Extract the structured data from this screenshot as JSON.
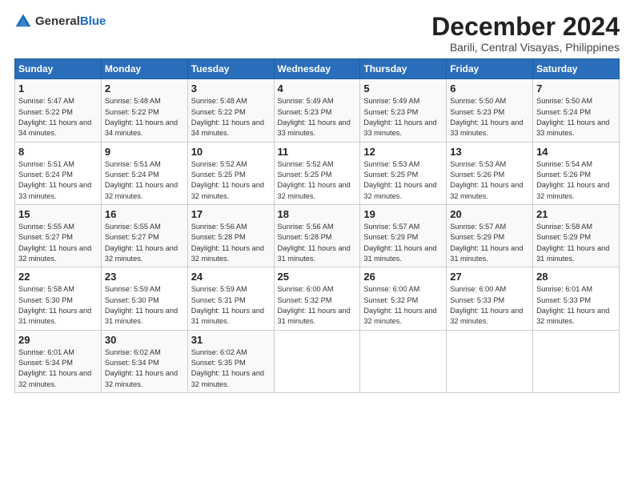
{
  "logo": {
    "general": "General",
    "blue": "Blue"
  },
  "title": "December 2024",
  "location": "Barili, Central Visayas, Philippines",
  "weekdays": [
    "Sunday",
    "Monday",
    "Tuesday",
    "Wednesday",
    "Thursday",
    "Friday",
    "Saturday"
  ],
  "weeks": [
    [
      {
        "day": "1",
        "sunrise": "Sunrise: 5:47 AM",
        "sunset": "Sunset: 5:22 PM",
        "daylight": "Daylight: 11 hours and 34 minutes."
      },
      {
        "day": "2",
        "sunrise": "Sunrise: 5:48 AM",
        "sunset": "Sunset: 5:22 PM",
        "daylight": "Daylight: 11 hours and 34 minutes."
      },
      {
        "day": "3",
        "sunrise": "Sunrise: 5:48 AM",
        "sunset": "Sunset: 5:22 PM",
        "daylight": "Daylight: 11 hours and 34 minutes."
      },
      {
        "day": "4",
        "sunrise": "Sunrise: 5:49 AM",
        "sunset": "Sunset: 5:23 PM",
        "daylight": "Daylight: 11 hours and 33 minutes."
      },
      {
        "day": "5",
        "sunrise": "Sunrise: 5:49 AM",
        "sunset": "Sunset: 5:23 PM",
        "daylight": "Daylight: 11 hours and 33 minutes."
      },
      {
        "day": "6",
        "sunrise": "Sunrise: 5:50 AM",
        "sunset": "Sunset: 5:23 PM",
        "daylight": "Daylight: 11 hours and 33 minutes."
      },
      {
        "day": "7",
        "sunrise": "Sunrise: 5:50 AM",
        "sunset": "Sunset: 5:24 PM",
        "daylight": "Daylight: 11 hours and 33 minutes."
      }
    ],
    [
      {
        "day": "8",
        "sunrise": "Sunrise: 5:51 AM",
        "sunset": "Sunset: 5:24 PM",
        "daylight": "Daylight: 11 hours and 33 minutes."
      },
      {
        "day": "9",
        "sunrise": "Sunrise: 5:51 AM",
        "sunset": "Sunset: 5:24 PM",
        "daylight": "Daylight: 11 hours and 32 minutes."
      },
      {
        "day": "10",
        "sunrise": "Sunrise: 5:52 AM",
        "sunset": "Sunset: 5:25 PM",
        "daylight": "Daylight: 11 hours and 32 minutes."
      },
      {
        "day": "11",
        "sunrise": "Sunrise: 5:52 AM",
        "sunset": "Sunset: 5:25 PM",
        "daylight": "Daylight: 11 hours and 32 minutes."
      },
      {
        "day": "12",
        "sunrise": "Sunrise: 5:53 AM",
        "sunset": "Sunset: 5:25 PM",
        "daylight": "Daylight: 11 hours and 32 minutes."
      },
      {
        "day": "13",
        "sunrise": "Sunrise: 5:53 AM",
        "sunset": "Sunset: 5:26 PM",
        "daylight": "Daylight: 11 hours and 32 minutes."
      },
      {
        "day": "14",
        "sunrise": "Sunrise: 5:54 AM",
        "sunset": "Sunset: 5:26 PM",
        "daylight": "Daylight: 11 hours and 32 minutes."
      }
    ],
    [
      {
        "day": "15",
        "sunrise": "Sunrise: 5:55 AM",
        "sunset": "Sunset: 5:27 PM",
        "daylight": "Daylight: 11 hours and 32 minutes."
      },
      {
        "day": "16",
        "sunrise": "Sunrise: 5:55 AM",
        "sunset": "Sunset: 5:27 PM",
        "daylight": "Daylight: 11 hours and 32 minutes."
      },
      {
        "day": "17",
        "sunrise": "Sunrise: 5:56 AM",
        "sunset": "Sunset: 5:28 PM",
        "daylight": "Daylight: 11 hours and 32 minutes."
      },
      {
        "day": "18",
        "sunrise": "Sunrise: 5:56 AM",
        "sunset": "Sunset: 5:28 PM",
        "daylight": "Daylight: 11 hours and 31 minutes."
      },
      {
        "day": "19",
        "sunrise": "Sunrise: 5:57 AM",
        "sunset": "Sunset: 5:29 PM",
        "daylight": "Daylight: 11 hours and 31 minutes."
      },
      {
        "day": "20",
        "sunrise": "Sunrise: 5:57 AM",
        "sunset": "Sunset: 5:29 PM",
        "daylight": "Daylight: 11 hours and 31 minutes."
      },
      {
        "day": "21",
        "sunrise": "Sunrise: 5:58 AM",
        "sunset": "Sunset: 5:29 PM",
        "daylight": "Daylight: 11 hours and 31 minutes."
      }
    ],
    [
      {
        "day": "22",
        "sunrise": "Sunrise: 5:58 AM",
        "sunset": "Sunset: 5:30 PM",
        "daylight": "Daylight: 11 hours and 31 minutes."
      },
      {
        "day": "23",
        "sunrise": "Sunrise: 5:59 AM",
        "sunset": "Sunset: 5:30 PM",
        "daylight": "Daylight: 11 hours and 31 minutes."
      },
      {
        "day": "24",
        "sunrise": "Sunrise: 5:59 AM",
        "sunset": "Sunset: 5:31 PM",
        "daylight": "Daylight: 11 hours and 31 minutes."
      },
      {
        "day": "25",
        "sunrise": "Sunrise: 6:00 AM",
        "sunset": "Sunset: 5:32 PM",
        "daylight": "Daylight: 11 hours and 31 minutes."
      },
      {
        "day": "26",
        "sunrise": "Sunrise: 6:00 AM",
        "sunset": "Sunset: 5:32 PM",
        "daylight": "Daylight: 11 hours and 32 minutes."
      },
      {
        "day": "27",
        "sunrise": "Sunrise: 6:00 AM",
        "sunset": "Sunset: 5:33 PM",
        "daylight": "Daylight: 11 hours and 32 minutes."
      },
      {
        "day": "28",
        "sunrise": "Sunrise: 6:01 AM",
        "sunset": "Sunset: 5:33 PM",
        "daylight": "Daylight: 11 hours and 32 minutes."
      }
    ],
    [
      {
        "day": "29",
        "sunrise": "Sunrise: 6:01 AM",
        "sunset": "Sunset: 5:34 PM",
        "daylight": "Daylight: 11 hours and 32 minutes."
      },
      {
        "day": "30",
        "sunrise": "Sunrise: 6:02 AM",
        "sunset": "Sunset: 5:34 PM",
        "daylight": "Daylight: 11 hours and 32 minutes."
      },
      {
        "day": "31",
        "sunrise": "Sunrise: 6:02 AM",
        "sunset": "Sunset: 5:35 PM",
        "daylight": "Daylight: 11 hours and 32 minutes."
      },
      null,
      null,
      null,
      null
    ]
  ]
}
